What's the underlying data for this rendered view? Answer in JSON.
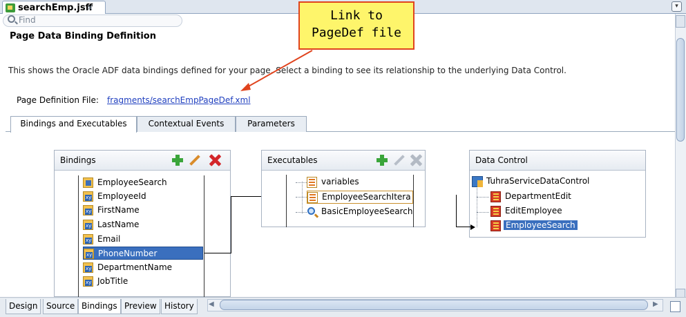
{
  "editor": {
    "file_tab": "searchEmp.jsff",
    "close_glyph": "×",
    "menu_glyph": "▾",
    "find_placeholder": "Find"
  },
  "page": {
    "title": "Page Data Binding Definition",
    "description": "This shows the Oracle ADF data bindings defined for your page. Select a binding to see its relationship to the underlying Data Control.",
    "pagedef_label": "Page Definition File:",
    "pagedef_link": "fragments/searchEmpPageDef.xml"
  },
  "inner_tabs": [
    "Bindings and Executables",
    "Contextual Events",
    "Parameters"
  ],
  "bindings": {
    "title": "Bindings",
    "items": [
      {
        "label": "EmployeeSearch",
        "icon": "iterator-binding-icon"
      },
      {
        "label": "EmployeeId",
        "icon": "attribute-binding-icon"
      },
      {
        "label": "FirstName",
        "icon": "attribute-binding-icon"
      },
      {
        "label": "LastName",
        "icon": "attribute-binding-icon"
      },
      {
        "label": "Email",
        "icon": "attribute-binding-icon"
      },
      {
        "label": "PhoneNumber",
        "icon": "attribute-binding-icon",
        "selected": true
      },
      {
        "label": "DepartmentName",
        "icon": "attribute-binding-icon"
      },
      {
        "label": "JobTitle",
        "icon": "attribute-binding-icon"
      }
    ]
  },
  "executables": {
    "title": "Executables",
    "items": [
      {
        "label": "variables",
        "icon": "variables-icon"
      },
      {
        "label": "EmployeeSearchItera",
        "icon": "iterator-icon"
      },
      {
        "label": "BasicEmployeeSearch",
        "icon": "search-icon"
      }
    ]
  },
  "data_control": {
    "title": "Data Control",
    "root": "TuhraServiceDataControl",
    "children": [
      "DepartmentEdit",
      "EditEmployee",
      "EmployeeSearch"
    ],
    "selected": "EmployeeSearch"
  },
  "callout": {
    "line1": "Link to",
    "line2": "PageDef file",
    "fill": "#fef56b",
    "border": "#e0431d"
  },
  "bottom_tabs": [
    "Design",
    "Source",
    "Bindings",
    "Preview",
    "History"
  ],
  "active_bottom_tab": "Bindings",
  "colors": {
    "selection": "#3a6fbe",
    "link": "#1f3fbf",
    "add": "#3aa53a",
    "delete": "#d3262a"
  }
}
